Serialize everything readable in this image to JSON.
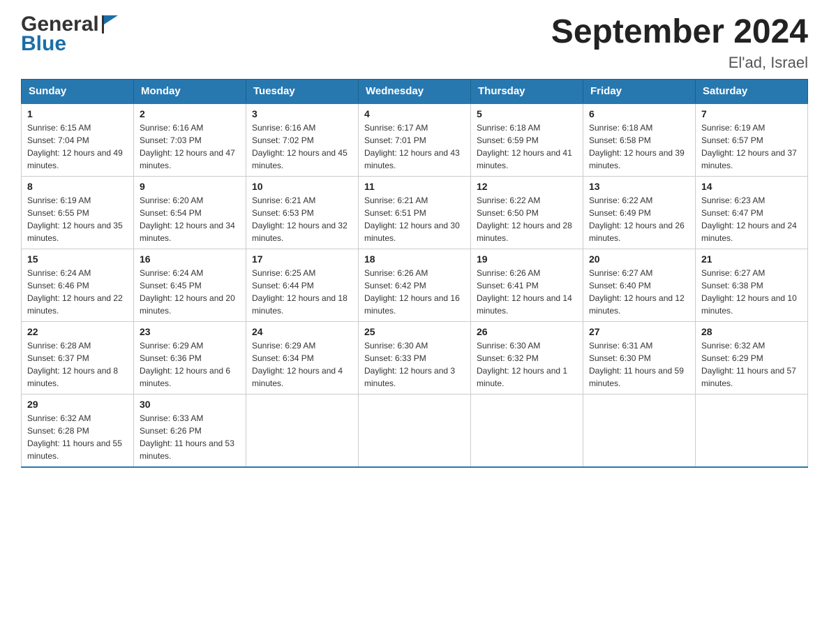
{
  "header": {
    "title": "September 2024",
    "location": "El'ad, Israel",
    "logo_general": "General",
    "logo_blue": "Blue"
  },
  "calendar": {
    "days_of_week": [
      "Sunday",
      "Monday",
      "Tuesday",
      "Wednesday",
      "Thursday",
      "Friday",
      "Saturday"
    ],
    "weeks": [
      [
        {
          "day": "1",
          "sunrise": "6:15 AM",
          "sunset": "7:04 PM",
          "daylight": "12 hours and 49 minutes."
        },
        {
          "day": "2",
          "sunrise": "6:16 AM",
          "sunset": "7:03 PM",
          "daylight": "12 hours and 47 minutes."
        },
        {
          "day": "3",
          "sunrise": "6:16 AM",
          "sunset": "7:02 PM",
          "daylight": "12 hours and 45 minutes."
        },
        {
          "day": "4",
          "sunrise": "6:17 AM",
          "sunset": "7:01 PM",
          "daylight": "12 hours and 43 minutes."
        },
        {
          "day": "5",
          "sunrise": "6:18 AM",
          "sunset": "6:59 PM",
          "daylight": "12 hours and 41 minutes."
        },
        {
          "day": "6",
          "sunrise": "6:18 AM",
          "sunset": "6:58 PM",
          "daylight": "12 hours and 39 minutes."
        },
        {
          "day": "7",
          "sunrise": "6:19 AM",
          "sunset": "6:57 PM",
          "daylight": "12 hours and 37 minutes."
        }
      ],
      [
        {
          "day": "8",
          "sunrise": "6:19 AM",
          "sunset": "6:55 PM",
          "daylight": "12 hours and 35 minutes."
        },
        {
          "day": "9",
          "sunrise": "6:20 AM",
          "sunset": "6:54 PM",
          "daylight": "12 hours and 34 minutes."
        },
        {
          "day": "10",
          "sunrise": "6:21 AM",
          "sunset": "6:53 PM",
          "daylight": "12 hours and 32 minutes."
        },
        {
          "day": "11",
          "sunrise": "6:21 AM",
          "sunset": "6:51 PM",
          "daylight": "12 hours and 30 minutes."
        },
        {
          "day": "12",
          "sunrise": "6:22 AM",
          "sunset": "6:50 PM",
          "daylight": "12 hours and 28 minutes."
        },
        {
          "day": "13",
          "sunrise": "6:22 AM",
          "sunset": "6:49 PM",
          "daylight": "12 hours and 26 minutes."
        },
        {
          "day": "14",
          "sunrise": "6:23 AM",
          "sunset": "6:47 PM",
          "daylight": "12 hours and 24 minutes."
        }
      ],
      [
        {
          "day": "15",
          "sunrise": "6:24 AM",
          "sunset": "6:46 PM",
          "daylight": "12 hours and 22 minutes."
        },
        {
          "day": "16",
          "sunrise": "6:24 AM",
          "sunset": "6:45 PM",
          "daylight": "12 hours and 20 minutes."
        },
        {
          "day": "17",
          "sunrise": "6:25 AM",
          "sunset": "6:44 PM",
          "daylight": "12 hours and 18 minutes."
        },
        {
          "day": "18",
          "sunrise": "6:26 AM",
          "sunset": "6:42 PM",
          "daylight": "12 hours and 16 minutes."
        },
        {
          "day": "19",
          "sunrise": "6:26 AM",
          "sunset": "6:41 PM",
          "daylight": "12 hours and 14 minutes."
        },
        {
          "day": "20",
          "sunrise": "6:27 AM",
          "sunset": "6:40 PM",
          "daylight": "12 hours and 12 minutes."
        },
        {
          "day": "21",
          "sunrise": "6:27 AM",
          "sunset": "6:38 PM",
          "daylight": "12 hours and 10 minutes."
        }
      ],
      [
        {
          "day": "22",
          "sunrise": "6:28 AM",
          "sunset": "6:37 PM",
          "daylight": "12 hours and 8 minutes."
        },
        {
          "day": "23",
          "sunrise": "6:29 AM",
          "sunset": "6:36 PM",
          "daylight": "12 hours and 6 minutes."
        },
        {
          "day": "24",
          "sunrise": "6:29 AM",
          "sunset": "6:34 PM",
          "daylight": "12 hours and 4 minutes."
        },
        {
          "day": "25",
          "sunrise": "6:30 AM",
          "sunset": "6:33 PM",
          "daylight": "12 hours and 3 minutes."
        },
        {
          "day": "26",
          "sunrise": "6:30 AM",
          "sunset": "6:32 PM",
          "daylight": "12 hours and 1 minute."
        },
        {
          "day": "27",
          "sunrise": "6:31 AM",
          "sunset": "6:30 PM",
          "daylight": "11 hours and 59 minutes."
        },
        {
          "day": "28",
          "sunrise": "6:32 AM",
          "sunset": "6:29 PM",
          "daylight": "11 hours and 57 minutes."
        }
      ],
      [
        {
          "day": "29",
          "sunrise": "6:32 AM",
          "sunset": "6:28 PM",
          "daylight": "11 hours and 55 minutes."
        },
        {
          "day": "30",
          "sunrise": "6:33 AM",
          "sunset": "6:26 PM",
          "daylight": "11 hours and 53 minutes."
        },
        null,
        null,
        null,
        null,
        null
      ]
    ]
  }
}
